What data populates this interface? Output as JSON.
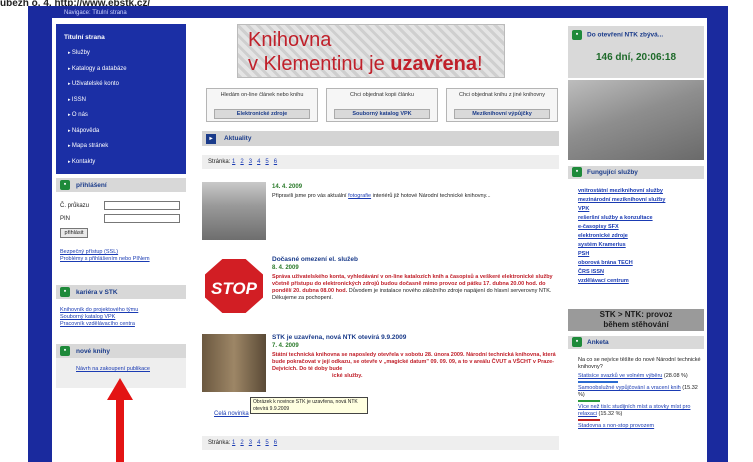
{
  "caption": {
    "prefix": "ubezh ö. 4, ",
    "link": "http://www.ebstk.cz/"
  },
  "breadcrumb": "Navigace: Titulní strana",
  "leftnav": {
    "title": "Titulní strana",
    "items": [
      "Služby",
      "Katalogy a databáze",
      "Uživatelské konto",
      "ISSN",
      "O nás",
      "Nápověda",
      "Mapa stránek",
      "Kontakty"
    ]
  },
  "login": {
    "heading": "přihlášení",
    "card_label": "Č. průkazu",
    "pin_label": "PIN",
    "button": "přihlásit",
    "link1": "Bezpečný přístup (SSL)",
    "link2": "Problémy s přihlášením nebo PINem"
  },
  "career": {
    "heading": "kariéra v STK",
    "links": [
      "Knihovník do projektového týmu",
      "Souborný katalog VPK",
      "Pracovník vzdělávacího centra"
    ]
  },
  "books": {
    "heading": "nové knihy",
    "link": "Návrh na zakoupení publikace"
  },
  "banner": {
    "line1": "Knihovna",
    "line2_prefix": "v Klementinu je ",
    "line2_emph": "uzavřena",
    "line2_suffix": "!"
  },
  "services": [
    {
      "text": "Hledám on-line článek nebo knihu",
      "button": "Elektronické zdroje"
    },
    {
      "text": "Chci objednat kopii článku",
      "button": "Souborný katalog VPK"
    },
    {
      "text": "Chci objednat knihu z jiné knihovny",
      "button": "Meziknihovní výpůjčky"
    }
  ],
  "news_heading": "Aktuality",
  "pager": {
    "label": "Stránka:",
    "pages": [
      "1",
      "2",
      "3",
      "4",
      "5",
      "6"
    ]
  },
  "news": [
    {
      "title": "",
      "date": "14. 4. 2009",
      "text_before": "Připravili jsme pro vás aktuální ",
      "link": "fotografie",
      "text_after": " interiérů již hotové Národní technické knihovny..."
    },
    {
      "title": "Dočasné omezení el. služeb",
      "date": "8. 4. 2009",
      "red": "Správa uživatelského konta, vyhledávání v on-line katalozích knih a časopisů a veškeré elektronické služby včetně přístupu do elektronických zdrojů budou dočasně mimo provoz od pátku 17. dubna 20.00 hod. do pondělí 20. dubna 08.00 hod.",
      "text": " Důvodem je instalace nového záložního zdroje napájení do hlavní serverovny NTK. Děkujeme za pochopení.",
      "sign": "STOP"
    },
    {
      "title": "STK je uzavřena, nová NTK otevírá 9.9.2009",
      "date": "7. 4. 2009",
      "red": "Státní technická knihovna se naposledy otevřela v sobotu 28. února 2009. Národní technická knihovna, která bude pokračovat v její odkazu, se otevře v „magické datum\" 09. 09. 09, a to v areálu ČVUT a VŠCHT v Praze-Dejvicích. Do té doby bude",
      "text_tail": "ické služby."
    }
  ],
  "tooltip": "Obrázek k novince STK je uzavřena, nová NTK otevírá 9.9.2009",
  "full_news": "Celá novinka",
  "countdown": {
    "heading": "Do otevření NTK zbývá...",
    "value": "146 dní, 20:06:18"
  },
  "functional": {
    "heading": "Fungující služby",
    "links": [
      "vnitrostátní meziknihovní služby",
      "mezinárodní meziknihovní služby",
      "VPK",
      "rešeršní služby a konzultace",
      "e-časopisy SFX",
      "elektronické zdroje",
      "systém Kramerius",
      "PSH",
      "oborová brána TECH",
      "ČRS ISSN",
      "vzdělávací centrum"
    ]
  },
  "stk_box": {
    "line1": "STK > NTK: provoz",
    "line2": "během stěhování"
  },
  "poll": {
    "heading": "Anketa",
    "question": "Na co se nejvíce těšíte do nové Národní technické knihovny?",
    "options": [
      {
        "label": "Statisíce svazků ve volném výběru",
        "pct": "(28.08 %)",
        "color": "#2a6ad0",
        "share": 28.08
      },
      {
        "label": "Samoobslužné vypůjčování a vracení knih",
        "pct": "(15.32 %)",
        "color": "#2a9a3a",
        "share": 15.32
      },
      {
        "label": "Více než tisíc studijních míst a stovky míst pro relaxaci",
        "pct": "(15.32 %)",
        "color": "#c02020",
        "share": 15.32
      },
      {
        "label": "Stadovna s non-stop provozem",
        "pct": "",
        "color": "#888888",
        "share": 0
      }
    ]
  },
  "colors": {
    "frame": "#1a2a9e",
    "accent_red": "#c0202a",
    "arrow": "#e31414"
  }
}
